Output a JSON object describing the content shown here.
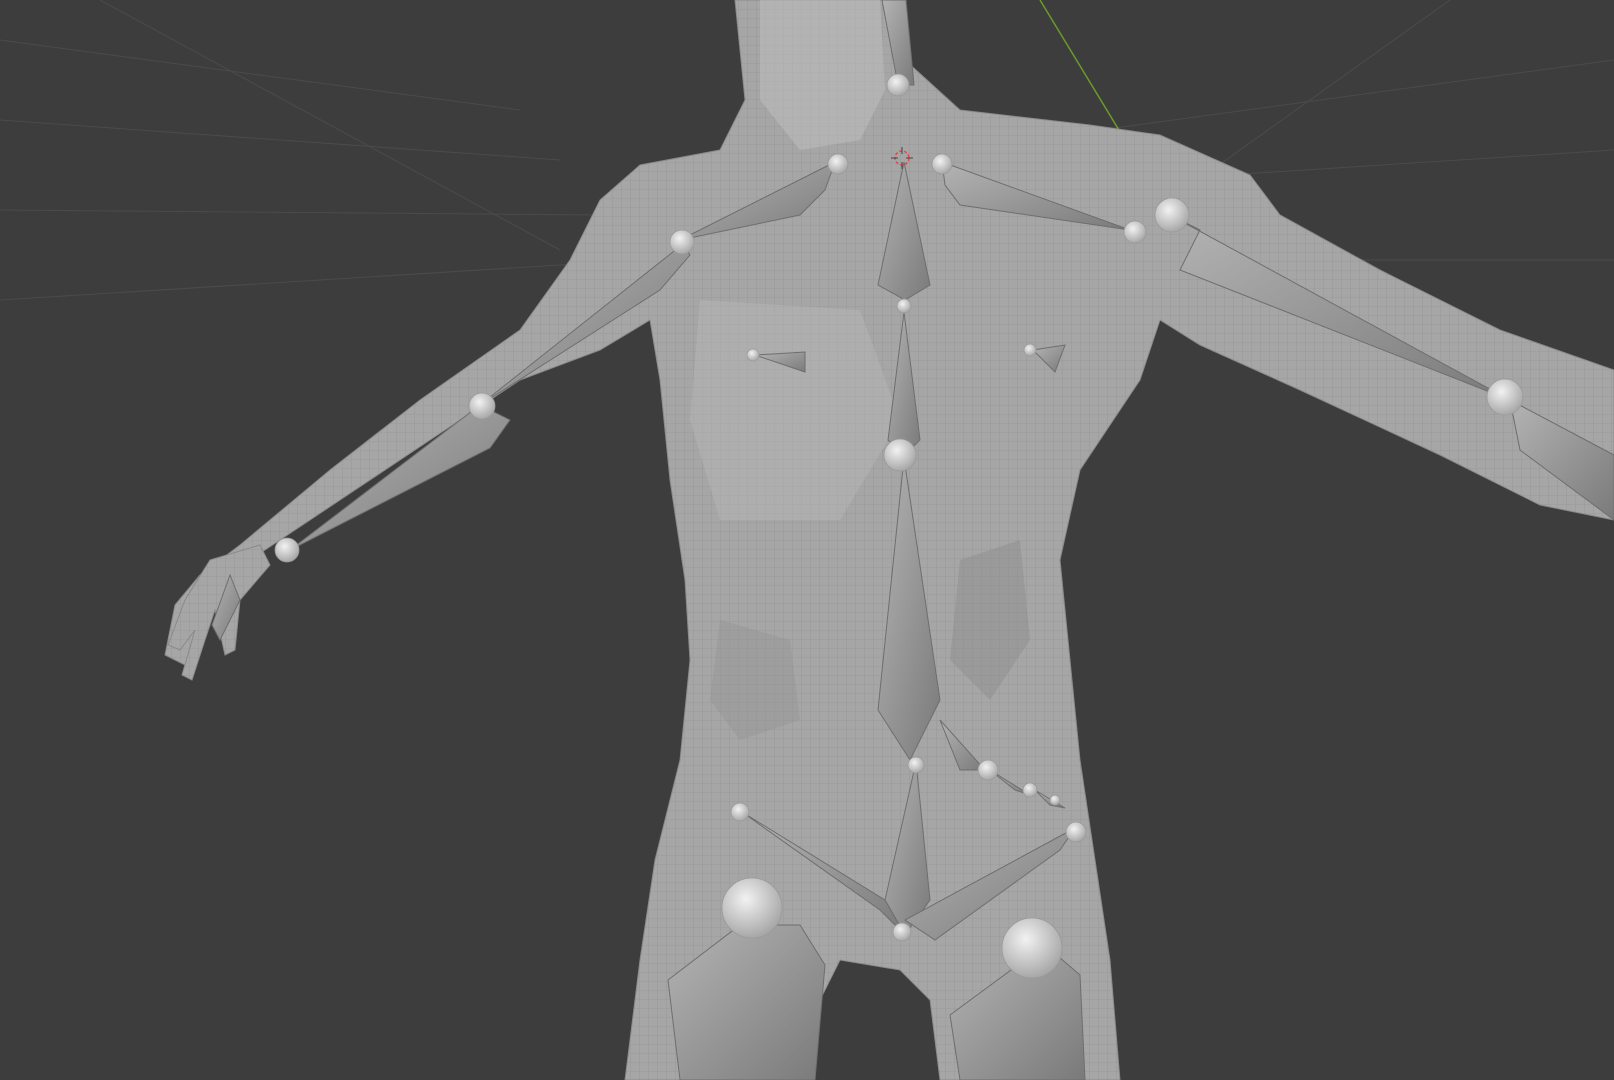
{
  "viewport": {
    "background": "#3d3d3d",
    "grid_color": "#4a4a4a",
    "axis_y_color": "#6a9a2a",
    "mesh_color": "#a9a9a9",
    "mesh_shadow": "#8c8c8c",
    "bone_color": "#9e9e9e",
    "bone_dark": "#7e7e7e",
    "joint_color": "#d8d8d8"
  },
  "overlays": {
    "cursor_3d": "3d-cursor-icon"
  }
}
